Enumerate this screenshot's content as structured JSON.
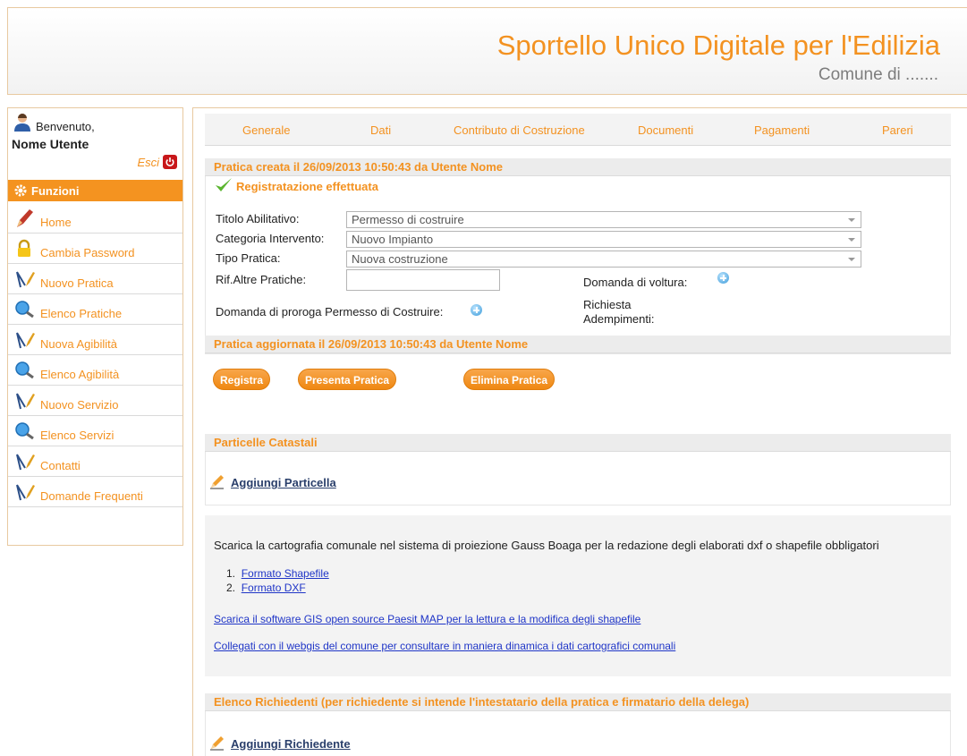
{
  "header": {
    "title": "Sportello Unico Digitale per l'Edilizia",
    "subtitle": "Comune di ......."
  },
  "sidebar": {
    "welcome": "Benvenuto,",
    "user_name": "Nome Utente",
    "logout_label": "Esci",
    "section_title": "Funzioni",
    "items": [
      {
        "label": "Home",
        "icon": "pencil-icon"
      },
      {
        "label": "Cambia Password",
        "icon": "lock-icon"
      },
      {
        "label": "Nuovo Pratica",
        "icon": "compass-pencil-icon"
      },
      {
        "label": "Elenco Pratiche",
        "icon": "magnifier-icon"
      },
      {
        "label": "Nuova Agibilità",
        "icon": "compass-pencil-icon"
      },
      {
        "label": "Elenco Agibilità",
        "icon": "magnifier-icon"
      },
      {
        "label": "Nuovo Servizio",
        "icon": "compass-pencil-icon"
      },
      {
        "label": "Elenco Servizi",
        "icon": "magnifier-icon"
      },
      {
        "label": "Contatti",
        "icon": "compass-pencil-icon"
      },
      {
        "label": "Domande Frequenti",
        "icon": "compass-pencil-icon"
      }
    ]
  },
  "tabs": [
    "Generale",
    "Dati",
    "Contributo di Costruzione",
    "Documenti",
    "Pagamenti",
    "Pareri"
  ],
  "pratica": {
    "created_bar": "Pratica creata il 26/09/2013 10:50:43 da Utente Nome",
    "success_message": "Registratazione effettuata",
    "titolo_label": "Titolo Abilitativo:",
    "titolo_value": "Permesso di costruire",
    "categoria_label": "Categoria Intervento:",
    "categoria_value": "Nuovo Impianto",
    "tipo_label": "Tipo Pratica:",
    "tipo_value": "Nuova costruzione",
    "rif_label": "Rif.Altre Pratiche:",
    "voltura_label": "Domanda di voltura:",
    "proroga_label": "Domanda di proroga Permesso di Costruire:",
    "richiesta_label_1": "Richiesta",
    "richiesta_label_2": "Adempimenti:",
    "updated_bar": "Pratica aggiornata il 26/09/2013 10:50:43 da Utente Nome"
  },
  "buttons": {
    "registra": "Registra",
    "presenta": "Presenta Pratica",
    "elimina": "Elimina Pratica"
  },
  "particelle": {
    "title": "Particelle Catastali",
    "add_label": "Aggiungi Particella"
  },
  "cartografia": {
    "text": "Scarica la cartografia comunale nel sistema di proiezione Gauss Boaga per la redazione degli elaborati dxf o shapefile obbligatori",
    "items": [
      "Formato Shapefile",
      "Formato DXF"
    ],
    "gis_link": "Scarica il software GIS open source Paesit MAP per la lettura e la modifica degli shapefile",
    "webgis_link": "Collegati con il webgis del comune per consultare in maniera dinamica i dati cartografici comunali"
  },
  "richiedenti": {
    "title": "Elenco Richiedenti (per richiedente si intende l'intestatario della pratica e firmatario della delega)",
    "add_label": "Aggiungi Richiedente"
  },
  "colors": {
    "accent": "#f39221",
    "border": "#e8c9a0",
    "link": "#1f35c7"
  }
}
